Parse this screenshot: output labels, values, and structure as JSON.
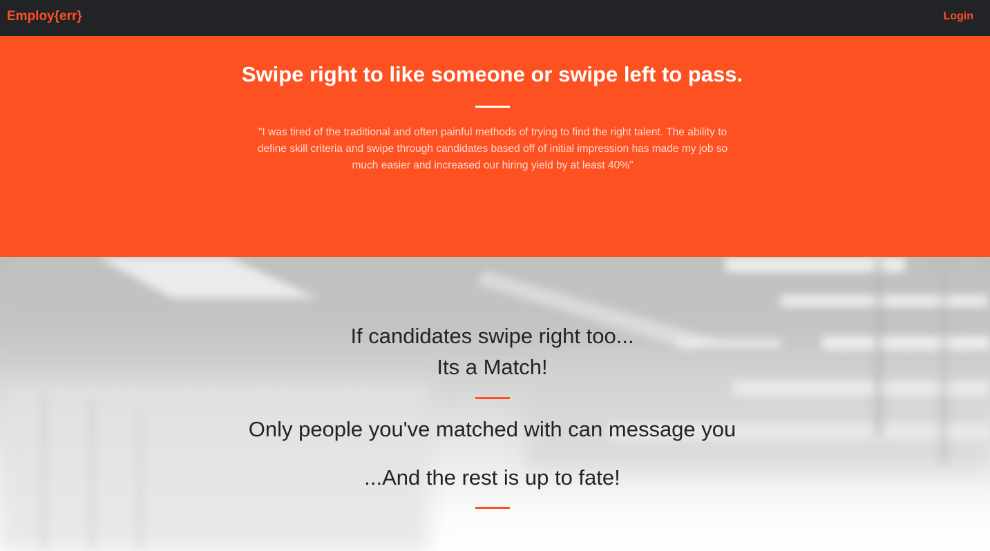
{
  "colors": {
    "accent": "#fe5121",
    "navbar_bg": "#222327",
    "text_dark": "#222327",
    "text_light": "#ffffff"
  },
  "navbar": {
    "brand": "Employ{err}",
    "login_label": "Login"
  },
  "hero": {
    "title": "Swipe right to like someone or swipe left to pass.",
    "quote": "\"I was tired of the traditional and often painful methods of trying to find the right talent. The ability to define skill criteria and swipe through candidates based off of initial impression has made my job so much easier and increased our hiring yield by at least 40%\""
  },
  "match_section": {
    "line1": "If candidates swipe right too...",
    "line2": "Its a Match!",
    "line3": "Only people you've matched with can message you",
    "line4": "...And the rest is up to fate!"
  }
}
